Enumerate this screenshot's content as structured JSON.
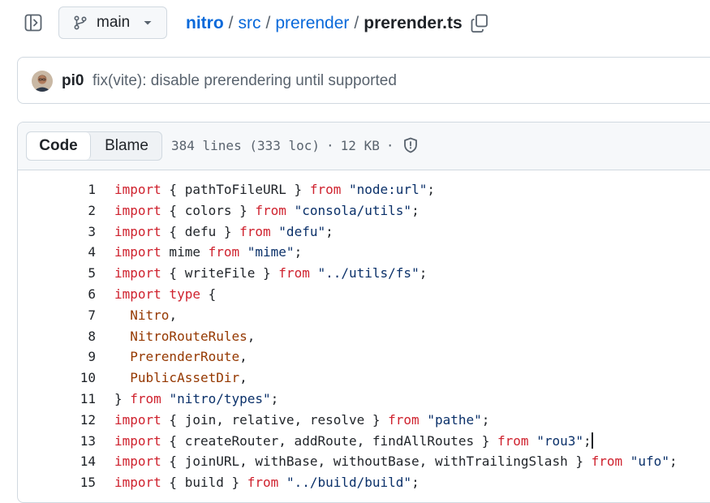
{
  "branch": {
    "label": "main"
  },
  "breadcrumb": {
    "root": "nitro",
    "sep": "/",
    "dir1": "src",
    "dir2": "prerender",
    "file": "prerender.ts"
  },
  "commit": {
    "author": "pi0",
    "message": "fix(vite): disable prerendering until supported"
  },
  "file_header": {
    "tabs": [
      "Code",
      "Blame"
    ],
    "active_tab": "Code",
    "lines_info": "384 lines (333 loc)",
    "dot": "·",
    "size": "12 KB"
  },
  "icons": {
    "sidebar": "sidebar-expand-icon",
    "branch": "git-branch-icon",
    "caret": "triangle-down-icon",
    "copy": "copy-icon",
    "shield": "shield-icon"
  },
  "colors": {
    "keyword": "#cf222e",
    "string": "#0a3069",
    "type": "#953800",
    "link": "#0969da"
  },
  "code": {
    "lines": [
      {
        "n": "1",
        "t": [
          [
            "kw",
            "import"
          ],
          [
            "txt",
            " { pathToFileURL } "
          ],
          [
            "kw",
            "from"
          ],
          [
            "txt",
            " "
          ],
          [
            "str",
            "\"node:url\""
          ],
          [
            "txt",
            ";"
          ]
        ]
      },
      {
        "n": "2",
        "t": [
          [
            "kw",
            "import"
          ],
          [
            "txt",
            " { colors } "
          ],
          [
            "kw",
            "from"
          ],
          [
            "txt",
            " "
          ],
          [
            "str",
            "\"consola/utils\""
          ],
          [
            "txt",
            ";"
          ]
        ]
      },
      {
        "n": "3",
        "t": [
          [
            "kw",
            "import"
          ],
          [
            "txt",
            " { defu } "
          ],
          [
            "kw",
            "from"
          ],
          [
            "txt",
            " "
          ],
          [
            "str",
            "\"defu\""
          ],
          [
            "txt",
            ";"
          ]
        ]
      },
      {
        "n": "4",
        "t": [
          [
            "kw",
            "import"
          ],
          [
            "txt",
            " mime "
          ],
          [
            "kw",
            "from"
          ],
          [
            "txt",
            " "
          ],
          [
            "str",
            "\"mime\""
          ],
          [
            "txt",
            ";"
          ]
        ]
      },
      {
        "n": "5",
        "t": [
          [
            "kw",
            "import"
          ],
          [
            "txt",
            " { writeFile } "
          ],
          [
            "kw",
            "from"
          ],
          [
            "txt",
            " "
          ],
          [
            "str",
            "\"../utils/fs\""
          ],
          [
            "txt",
            ";"
          ]
        ]
      },
      {
        "n": "6",
        "t": [
          [
            "kw",
            "import"
          ],
          [
            "txt",
            " "
          ],
          [
            "kw",
            "type"
          ],
          [
            "txt",
            " {"
          ]
        ]
      },
      {
        "n": "7",
        "t": [
          [
            "txt",
            "  "
          ],
          [
            "typ",
            "Nitro"
          ],
          [
            "txt",
            ","
          ]
        ]
      },
      {
        "n": "8",
        "t": [
          [
            "txt",
            "  "
          ],
          [
            "typ",
            "NitroRouteRules"
          ],
          [
            "txt",
            ","
          ]
        ]
      },
      {
        "n": "9",
        "t": [
          [
            "txt",
            "  "
          ],
          [
            "typ",
            "PrerenderRoute"
          ],
          [
            "txt",
            ","
          ]
        ]
      },
      {
        "n": "10",
        "t": [
          [
            "txt",
            "  "
          ],
          [
            "typ",
            "PublicAssetDir"
          ],
          [
            "txt",
            ","
          ]
        ]
      },
      {
        "n": "11",
        "t": [
          [
            "txt",
            "} "
          ],
          [
            "kw",
            "from"
          ],
          [
            "txt",
            " "
          ],
          [
            "str",
            "\"nitro/types\""
          ],
          [
            "txt",
            ";"
          ]
        ]
      },
      {
        "n": "12",
        "t": [
          [
            "kw",
            "import"
          ],
          [
            "txt",
            " { join, relative, resolve } "
          ],
          [
            "kw",
            "from"
          ],
          [
            "txt",
            " "
          ],
          [
            "str",
            "\"pathe\""
          ],
          [
            "txt",
            ";"
          ]
        ]
      },
      {
        "n": "13",
        "t": [
          [
            "kw",
            "import"
          ],
          [
            "txt",
            " { createRouter, addRoute, findAllRoutes } "
          ],
          [
            "kw",
            "from"
          ],
          [
            "txt",
            " "
          ],
          [
            "str",
            "\"rou3\""
          ],
          [
            "txt",
            ";"
          ],
          [
            "cursor",
            ""
          ]
        ]
      },
      {
        "n": "14",
        "t": [
          [
            "kw",
            "import"
          ],
          [
            "txt",
            " { joinURL, withBase, withoutBase, withTrailingSlash } "
          ],
          [
            "kw",
            "from"
          ],
          [
            "txt",
            " "
          ],
          [
            "str",
            "\"ufo\""
          ],
          [
            "txt",
            ";"
          ]
        ]
      },
      {
        "n": "15",
        "t": [
          [
            "kw",
            "import"
          ],
          [
            "txt",
            " { build } "
          ],
          [
            "kw",
            "from"
          ],
          [
            "txt",
            " "
          ],
          [
            "str",
            "\"../build/build\""
          ],
          [
            "txt",
            ";"
          ]
        ]
      }
    ]
  }
}
